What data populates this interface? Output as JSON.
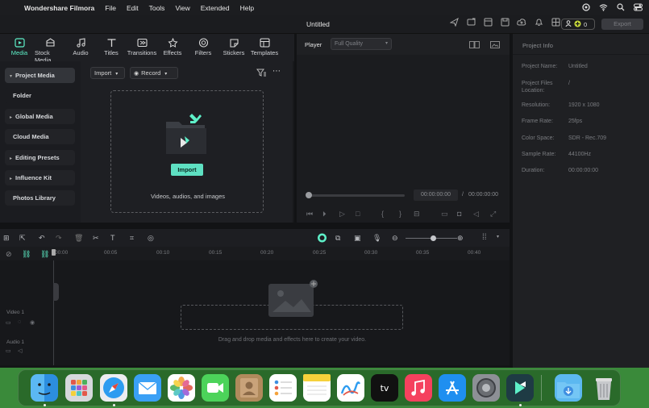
{
  "menubar": {
    "app_name": "Wondershare Filmora",
    "items": [
      "File",
      "Edit",
      "Tools",
      "View",
      "Extended",
      "Help"
    ]
  },
  "window": {
    "title": "Untitled",
    "credits": "0",
    "export_label": "Export"
  },
  "toolbar": {
    "items": [
      {
        "label": "Media",
        "icon": "media-icon",
        "active": true
      },
      {
        "label": "Stock Media",
        "icon": "stock-media-icon"
      },
      {
        "label": "Audio",
        "icon": "music-note-icon"
      },
      {
        "label": "Titles",
        "icon": "text-icon"
      },
      {
        "label": "Transitions",
        "icon": "transition-icon"
      },
      {
        "label": "Effects",
        "icon": "effects-icon"
      },
      {
        "label": "Filters",
        "icon": "filters-icon"
      },
      {
        "label": "Stickers",
        "icon": "sticker-icon"
      },
      {
        "label": "Templates",
        "icon": "templates-icon"
      }
    ]
  },
  "sidebar": {
    "items": [
      {
        "label": "Project Media",
        "caret": "▾",
        "selected": true
      },
      {
        "label": "Folder",
        "caret": ""
      },
      {
        "label": "Global Media",
        "caret": "▸"
      },
      {
        "label": "Cloud Media",
        "caret": ""
      },
      {
        "label": "Editing Presets",
        "caret": "▸"
      },
      {
        "label": "Influence Kit",
        "caret": "▸"
      },
      {
        "label": "Photos Library",
        "caret": ""
      }
    ]
  },
  "media": {
    "import_dropdown": "Import",
    "record_dropdown": "Record",
    "import_button": "Import",
    "drop_hint": "Videos, audios, and images"
  },
  "player": {
    "label": "Player",
    "quality": "Full Quality",
    "current_time": "00:00:00:00",
    "separator": "/",
    "total_time": "00:00:00:00"
  },
  "project_info": {
    "title": "Project Info",
    "rows": [
      {
        "key": "Project Name:",
        "value": "Untitled"
      },
      {
        "key": "Project Files Location:",
        "value": "/"
      },
      {
        "key": "Resolution:",
        "value": "1920 x 1080"
      },
      {
        "key": "Frame Rate:",
        "value": "25fps"
      },
      {
        "key": "Color Space:",
        "value": "SDR - Rec.709"
      },
      {
        "key": "Sample Rate:",
        "value": "44100Hz"
      },
      {
        "key": "Duration:",
        "value": "00:00:00:00"
      }
    ]
  },
  "timeline": {
    "ruler": [
      "00:00",
      "00:05",
      "00:10",
      "00:15",
      "00:20",
      "00:25",
      "00:30",
      "00:35",
      "00:40"
    ],
    "video_track": "Video 1",
    "audio_track": "Audio 1",
    "drop_hint": "Drag and drop media and effects here to create your video.",
    "zoom_level": 0.7
  },
  "dock": {
    "apps": [
      "Finder",
      "Launchpad",
      "Safari",
      "Mail",
      "Photos",
      "FaceTime",
      "Contacts",
      "Reminders",
      "Notes",
      "Freeform",
      "Apple TV",
      "Music",
      "App Store",
      "System Settings",
      "Filmora",
      "Downloads",
      "Trash"
    ],
    "colors": {
      "accent": "#5ef0c8",
      "panel": "#1e1f23",
      "dock_bg": "#2e6b2e"
    }
  }
}
